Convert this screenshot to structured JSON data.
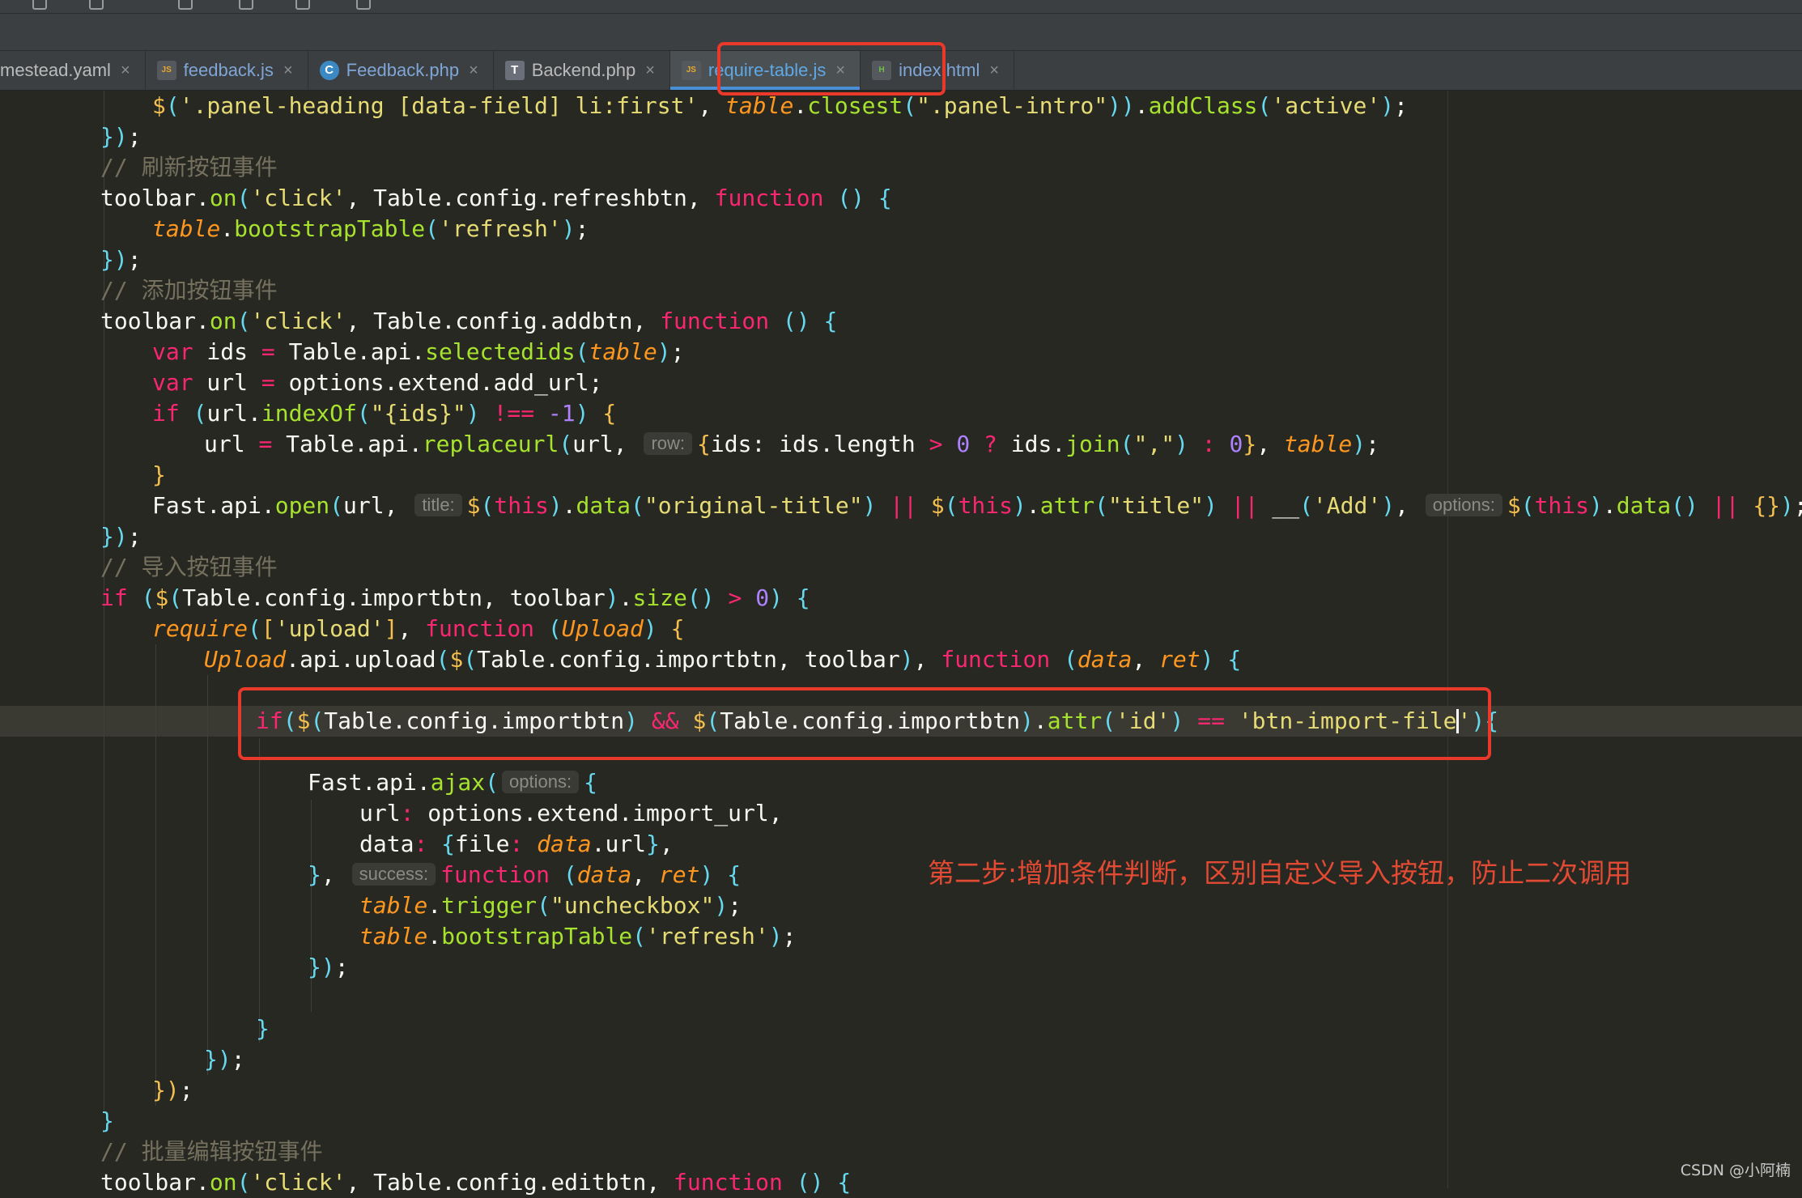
{
  "tabs": [
    {
      "label": "mestead.yaml",
      "icon": "yaml-file-icon"
    },
    {
      "label": "feedback.js",
      "icon": "js-file-icon"
    },
    {
      "label": "Feedback.php",
      "icon": "php-class-icon"
    },
    {
      "label": "Backend.php",
      "icon": "php-file-icon"
    },
    {
      "label": "require-table.js",
      "icon": "js-file-icon",
      "active": true
    },
    {
      "label": "index.html",
      "icon": "html-file-icon"
    }
  ],
  "tab_close_glyph": "×",
  "hints": {
    "row": "row:",
    "title": "title:",
    "options": "options:",
    "success": "success:"
  },
  "comments": {
    "refresh": "// 刷新按钮事件",
    "add": "// 添加按钮事件",
    "import": "// 导入按钮事件",
    "batch_edit": "// 批量编辑按钮事件"
  },
  "annotation": "第二步:增加条件判断，区别自定义导入按钮，防止二次调用",
  "watermark": "CSDN @小阿楠",
  "colors": {
    "editor_bg": "#272822",
    "highlight": "#e8392a",
    "annotation": "#e24a33",
    "active_tab": "#5fa8e6"
  }
}
